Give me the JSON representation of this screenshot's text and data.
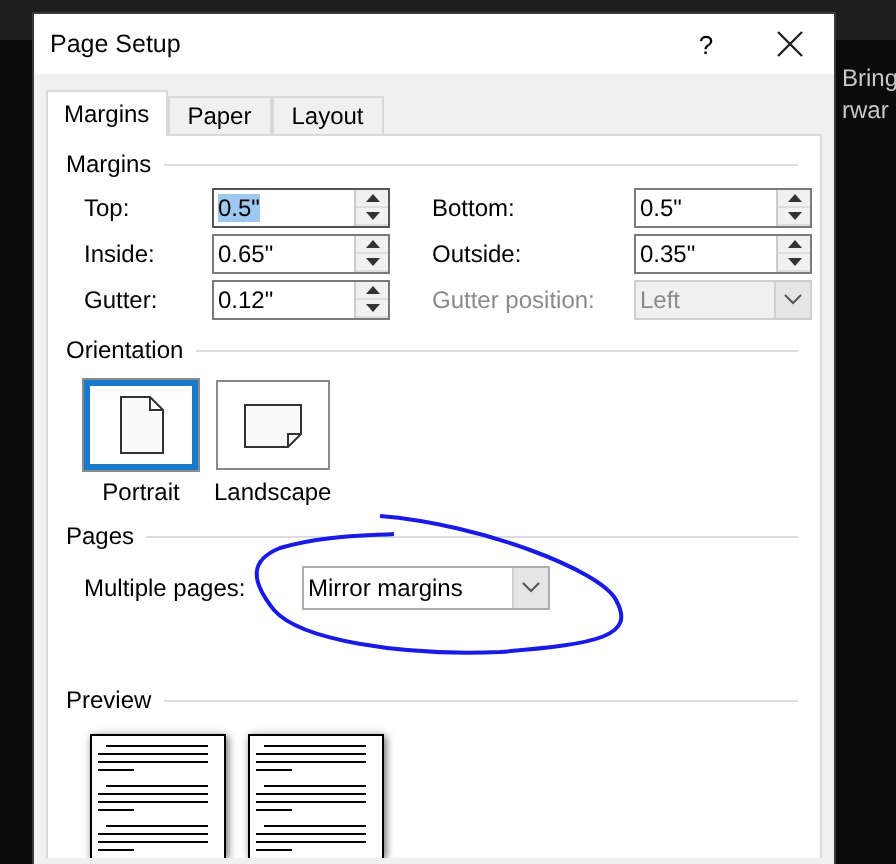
{
  "background": {
    "side_labels": [
      "Bring",
      "rwar"
    ]
  },
  "dialog": {
    "title": "Page Setup",
    "help": "?"
  },
  "tabs": [
    {
      "label": "Margins",
      "selected": true
    },
    {
      "label": "Paper",
      "selected": false
    },
    {
      "label": "Layout",
      "selected": false
    }
  ],
  "margins": {
    "heading": "Margins",
    "fields": [
      {
        "label": "Top:",
        "value": "0.5\"",
        "kind": "spin",
        "selected": true,
        "disabled": false
      },
      {
        "label": "Bottom:",
        "value": "0.5\"",
        "kind": "spin",
        "selected": false,
        "disabled": false
      },
      {
        "label": "Inside:",
        "value": "0.65\"",
        "kind": "spin",
        "selected": false,
        "disabled": false
      },
      {
        "label": "Outside:",
        "value": "0.35\"",
        "kind": "spin",
        "selected": false,
        "disabled": false
      },
      {
        "label": "Gutter:",
        "value": "0.12\"",
        "kind": "spin",
        "selected": false,
        "disabled": false
      },
      {
        "label": "Gutter position:",
        "value": "Left",
        "kind": "dropdown",
        "selected": false,
        "disabled": true
      }
    ]
  },
  "orientation": {
    "heading": "Orientation",
    "options": [
      {
        "label": "Portrait",
        "kind": "portrait",
        "selected": true
      },
      {
        "label": "Landscape",
        "kind": "landscape",
        "selected": false
      }
    ]
  },
  "pages": {
    "heading": "Pages",
    "label": "Multiple pages:",
    "value": "Mirror margins"
  },
  "preview": {
    "heading": "Preview"
  }
}
